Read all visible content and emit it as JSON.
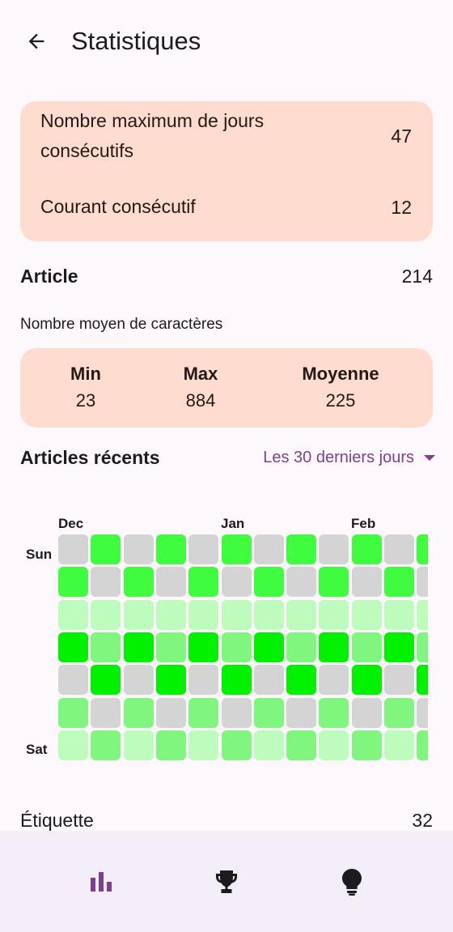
{
  "header": {
    "title": "Statistiques"
  },
  "streaks": {
    "max_label": "Nombre maximum de jours consécutifs",
    "max_value": "47",
    "current_label": "Courant consécutif",
    "current_value": "12"
  },
  "article": {
    "label": "Article",
    "value": "214"
  },
  "avg_chars": {
    "title": "Nombre moyen de caractères",
    "min_label": "Min",
    "min_value": "23",
    "max_label": "Max",
    "max_value": "884",
    "avg_label": "Moyenne",
    "avg_value": "225"
  },
  "recent": {
    "title": "Articles récents",
    "period": "Les 30 derniers jours"
  },
  "heatmap": {
    "months": [
      "Dec",
      "Jan",
      "Feb"
    ],
    "day_labels": {
      "first": "Sun",
      "last": "Sat"
    },
    "colors": [
      "#d4d4d4",
      "#bdfcbc",
      "#80f67e",
      "#3ffc3f",
      "#00f000"
    ],
    "rows": [
      [
        0,
        3,
        0,
        3,
        0,
        3,
        0,
        3,
        0,
        3,
        0,
        3
      ],
      [
        3,
        0,
        3,
        0,
        3,
        0,
        3,
        0,
        3,
        0,
        3,
        0
      ],
      [
        1,
        1,
        1,
        1,
        1,
        1,
        1,
        1,
        1,
        1,
        1,
        1
      ],
      [
        4,
        2,
        4,
        2,
        4,
        2,
        4,
        2,
        4,
        2,
        4,
        2
      ],
      [
        0,
        4,
        0,
        4,
        0,
        4,
        0,
        4,
        0,
        4,
        0,
        4
      ],
      [
        2,
        0,
        2,
        0,
        2,
        0,
        2,
        0,
        2,
        0,
        2,
        0
      ],
      [
        1,
        2,
        1,
        2,
        1,
        2,
        1,
        2,
        1,
        2,
        1,
        2
      ]
    ]
  },
  "tags": {
    "label": "Étiquette",
    "value": "32"
  },
  "navbar": {
    "items": [
      {
        "icon": "bar-chart-icon",
        "active": true
      },
      {
        "icon": "trophy-icon",
        "active": false
      },
      {
        "icon": "lightbulb-icon",
        "active": false
      }
    ],
    "active_color": "#7e3f91",
    "inactive_color": "#1d1b20"
  }
}
